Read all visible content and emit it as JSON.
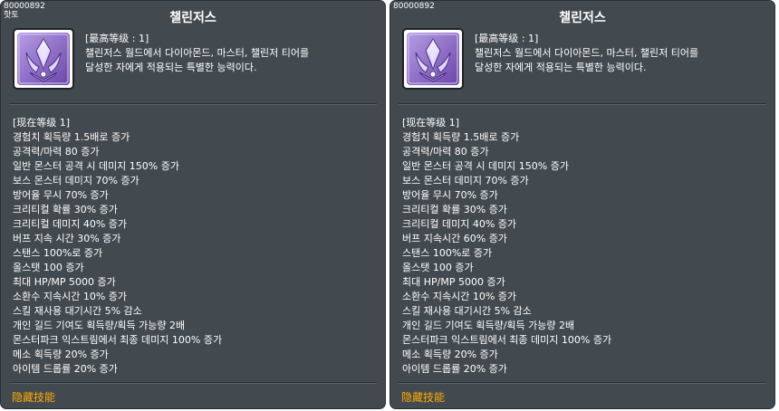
{
  "panels": [
    {
      "skill_id": "80000892",
      "sub_label": "핫토",
      "title": "챌린저스",
      "max_level": "[最高等级 : 1]",
      "desc_line1": "챌린저스 월드에서 다이아몬드, 마스터, 챌린저 티어를",
      "desc_line2": "달성한 자에게 적용되는 특별한 능력이다.",
      "current_level": "[现在等级 1]",
      "effects": [
        "경험치 획득량 1.5배로 증가",
        "공격력/마력 80 증가",
        "일반 몬스터 공격 시 데미지 150% 증가",
        "보스 몬스터  데미지 70% 증가",
        "방어율 무시 70% 증가",
        "크리티컬 확률 30% 증가",
        "크리티컬 데미지 40% 증가",
        "버프 지속 시간 30% 증가",
        "스탠스 100%로 증가",
        "올스탯 100 증가",
        "최대 HP/MP 5000 증가",
        "소환수 지속시간 10% 증가",
        "스킬 재사용 대기시간 5% 감소",
        "개인 길드 기여도 획득량/획득 가능량 2배",
        "몬스터파크 익스트림에서 최종 데미지 100% 증가",
        "메소 획득량 20% 증가",
        "아이템 드롭률 20% 증가"
      ],
      "hidden_label": "隐藏技能"
    },
    {
      "skill_id": "80000892",
      "sub_label": "",
      "title": "챌린저스",
      "max_level": "[最高等级 : 1]",
      "desc_line1": "챌린저스 월드에서 다이아몬드, 마스터, 챌린저 티어를",
      "desc_line2": "달성한 자에게 적용되는 특별한 능력이다.",
      "current_level": "[现在等级 1]",
      "effects": [
        "경험치 획득량 1.5배로 증가",
        "공격력/마력 80 증가",
        "일반 몬스터 공격 시 데미지 150% 증가",
        "보스 몬스터  데미지 70% 증가",
        "방어율 무시 70% 증가",
        "크리티컬 확률 30% 증가",
        "크리티컬 데미지 40% 증가",
        "버프 지속시간 60% 증가",
        "스탠스 100%로 증가",
        "올스탯 100 증가",
        "최대 HP/MP 5000 증가",
        "소환수 지속시간 10% 증가",
        "스킬 재사용 대기시간 5% 감소",
        "개인 길드 기여도 획득량/획득 가능량 2배",
        "몬스터파크 익스트림에서 최종 데미지 100% 증가",
        "메소 획득량 20% 증가",
        "아이템 드롭률 20% 증가"
      ],
      "hidden_label": "隐藏技能"
    }
  ],
  "colors": {
    "panel_bg": "#434a4f",
    "text": "#ffffff",
    "hidden_label": "#ffaa00",
    "icon_purple": "#8a63c9"
  },
  "icon": "challengers-crest-icon"
}
